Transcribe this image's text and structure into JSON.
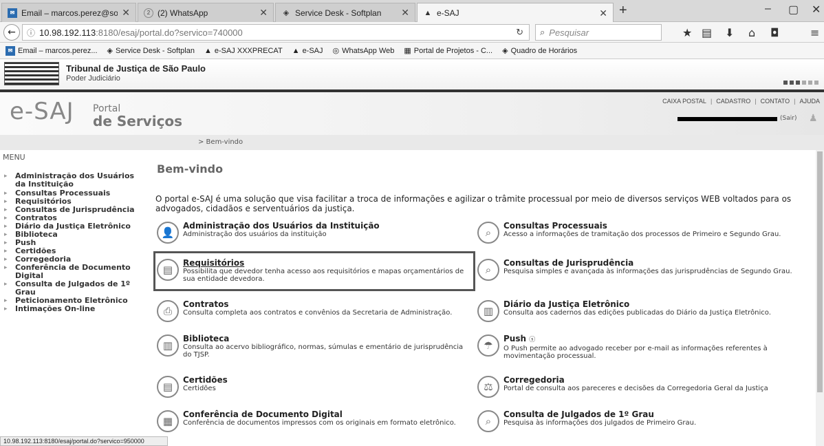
{
  "browser": {
    "tabs": [
      {
        "label": "Email – marcos.perez@softp",
        "icon": "mail-icon"
      },
      {
        "label": "(2) WhatsApp",
        "icon": "whatsapp-icon"
      },
      {
        "label": "Service Desk - Softplan",
        "icon": "shield-icon"
      },
      {
        "label": "e-SAJ",
        "icon": "esaj-icon"
      }
    ],
    "new_tab": "+",
    "window_controls": {
      "minimize": "–",
      "maximize": "▢",
      "close": "✕"
    },
    "url_host": "10.98.192.113",
    "url_path": ":8180/esaj/portal.do?servico=740000",
    "search_placeholder": "Pesquisar",
    "bookmarks": [
      {
        "label": "Email – marcos.perez...",
        "icon": "mail-icon"
      },
      {
        "label": "Service Desk - Softplan",
        "icon": "shield-icon"
      },
      {
        "label": "e-SAJ XXXPRECAT",
        "icon": "esaj-icon"
      },
      {
        "label": "e-SAJ",
        "icon": "esaj-icon"
      },
      {
        "label": "WhatsApp Web",
        "icon": "whatsapp-icon"
      },
      {
        "label": "Portal de Projetos - C...",
        "icon": "chart-icon"
      },
      {
        "label": "Quadro de Horários",
        "icon": "shield-icon"
      }
    ],
    "status_url": "10.98.192.113:8180/esaj/portal.do?servico=950000"
  },
  "header": {
    "court": "Tribunal de Justiça de São Paulo",
    "court_sub": "Poder Judiciário",
    "logo_text": "e-SAJ",
    "portal": "Portal",
    "servicos": "de Serviços",
    "top_links": [
      "CAIXA POSTAL",
      "CADASTRO",
      "CONTATO",
      "AJUDA"
    ],
    "sair": "(Sair)",
    "breadcrumb": "> Bem-vindo"
  },
  "menu": {
    "title": "MENU",
    "items": [
      "Administração dos Usuários da Instituição",
      "Consultas Processuais",
      "Requisitórios",
      "Consultas de Jurisprudência",
      "Contratos",
      "Diário da Justiça Eletrônico",
      "Biblioteca",
      "Push",
      "Certidões",
      "Corregedoria",
      "Conferência de Documento Digital",
      "Consulta de Julgados de 1º Grau",
      "Peticionamento Eletrônico",
      "Intimações On-line"
    ]
  },
  "main": {
    "title": "Bem-vindo",
    "intro": "O portal e-SAJ é uma solução que visa facilitar a troca de informações e agilizar o trâmite processual por meio de diversos serviços WEB voltados para os advogados, cidadãos e serventuários da justiça.",
    "left": [
      {
        "title": "Administração dos Usuários da Instituição",
        "desc": "Administração dos usuários da instituição",
        "icon": "user-icon"
      },
      {
        "title": "Requisitórios",
        "desc": "Possibilita que devedor tenha acesso aos requisitórios e mapas orçamentários de sua entidade devedora.",
        "icon": "document-icon"
      },
      {
        "title": "Contratos",
        "desc": "Consulta completa aos contratos e convênios da Secretaria de Administração.",
        "icon": "contract-icon"
      },
      {
        "title": "Biblioteca",
        "desc": "Consulta ao acervo bibliográfico, normas, súmulas e ementário de jurisprudência do TJSP.",
        "icon": "book-icon"
      },
      {
        "title": "Certidões",
        "desc": "Certidões",
        "icon": "certificate-icon"
      },
      {
        "title": "Conferência de Documento Digital",
        "desc": "Conferência de documentos impressos com os originais em formato eletrônico.",
        "icon": "digital-document-icon"
      }
    ],
    "right": [
      {
        "title": "Consultas Processuais",
        "desc": "Acesso a informações de tramitação dos processos de Primeiro e Segundo Grau.",
        "icon": "search-process-icon"
      },
      {
        "title": "Consultas de Jurisprudência",
        "desc": "Pesquisa simples e avançada às informações das jurisprudências de Segundo Grau.",
        "icon": "search-jurisprudence-icon"
      },
      {
        "title": "Diário da Justiça Eletrônico",
        "desc": "Consulta aos cadernos das edições publicadas do Diário da Justiça Eletrônico.",
        "icon": "journal-icon"
      },
      {
        "title": "Push",
        "desc": "O Push permite ao advogado receber por e-mail as informações referentes à movimentação processual.",
        "icon": "push-icon"
      },
      {
        "title": "Corregedoria",
        "desc": "Portal de consulta aos pareceres e decisões da Corregedoria Geral da Justiça",
        "icon": "scales-icon"
      },
      {
        "title": "Consulta de Julgados de 1º Grau",
        "desc": "Pesquisa às informações dos julgados de Primeiro Grau.",
        "icon": "search-judgment-icon"
      }
    ]
  }
}
